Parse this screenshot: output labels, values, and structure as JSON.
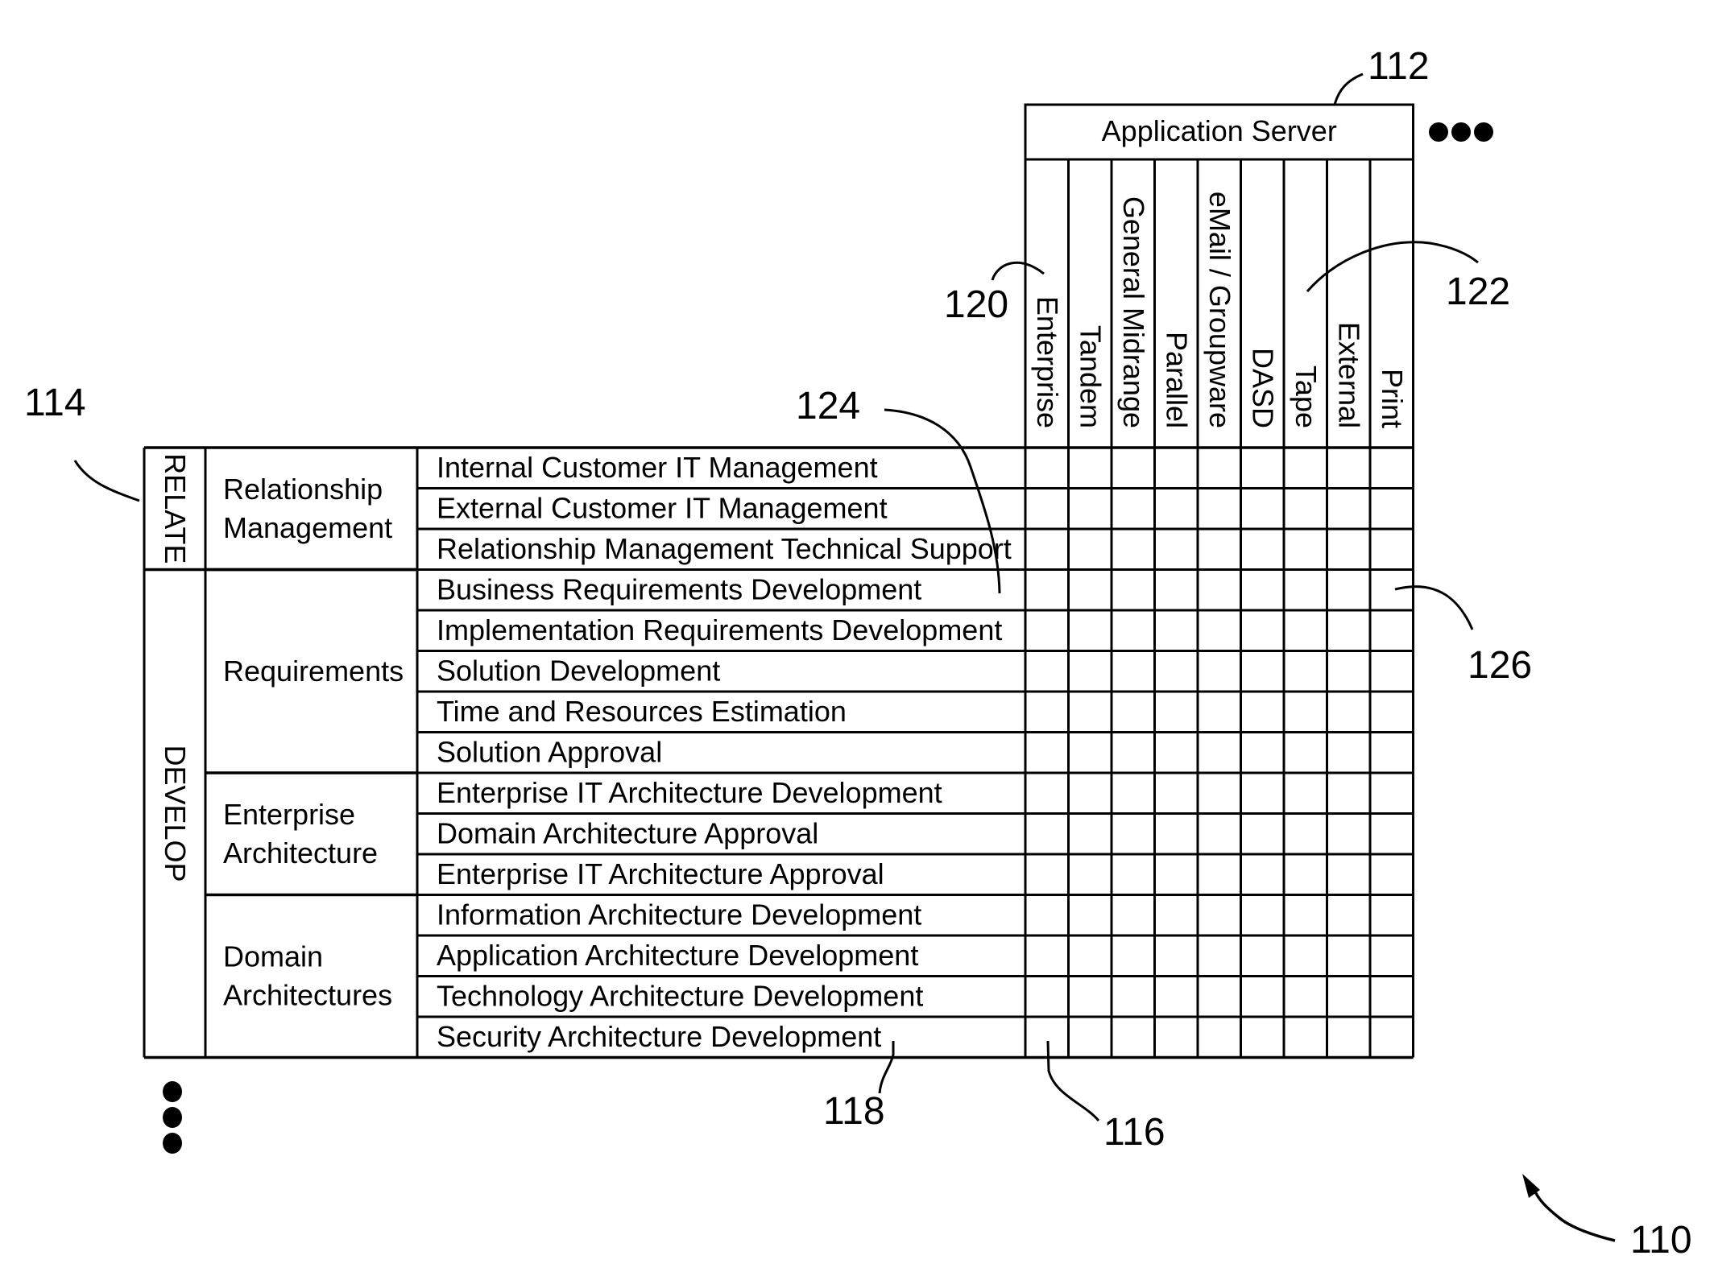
{
  "header": {
    "group_label": "Application Server",
    "columns": [
      "Enterprise",
      "Tandem",
      "General Midrange",
      "Parallel",
      "eMail / Groupware",
      "DASD",
      "Tape",
      "External",
      "Print"
    ]
  },
  "phases": [
    {
      "label": "RELATE",
      "rows": 3
    },
    {
      "label": "DEVELOP",
      "rows": 12
    }
  ],
  "groups": [
    {
      "label": [
        "Relationship",
        "Management"
      ],
      "rows": 3
    },
    {
      "label": [
        "Requirements"
      ],
      "rows": 5
    },
    {
      "label": [
        "Enterprise",
        "Architecture"
      ],
      "rows": 3
    },
    {
      "label": [
        "Domain",
        "Architectures"
      ],
      "rows": 4
    }
  ],
  "rows": [
    "Internal Customer IT Management",
    "External Customer IT Management",
    "Relationship Management Technical Support",
    "Business Requirements Development",
    "Implementation Requirements Development",
    "Solution Development",
    "Time and Resources Estimation",
    "Solution Approval",
    "Enterprise IT Architecture Development",
    "Domain Architecture Approval",
    "Enterprise IT Architecture Approval",
    "Information Architecture Development",
    "Application Architecture Development",
    "Technology Architecture Development",
    "Security Architecture Development"
  ],
  "references": {
    "figure": "110",
    "header": "112",
    "phase": "114",
    "cell": "116",
    "row": "118",
    "first_column": "120",
    "columns": "122",
    "row_group": "124",
    "grid": "126"
  },
  "continuation": {
    "right": "more-columns-ellipsis",
    "bottom": "more-rows-ellipsis"
  }
}
